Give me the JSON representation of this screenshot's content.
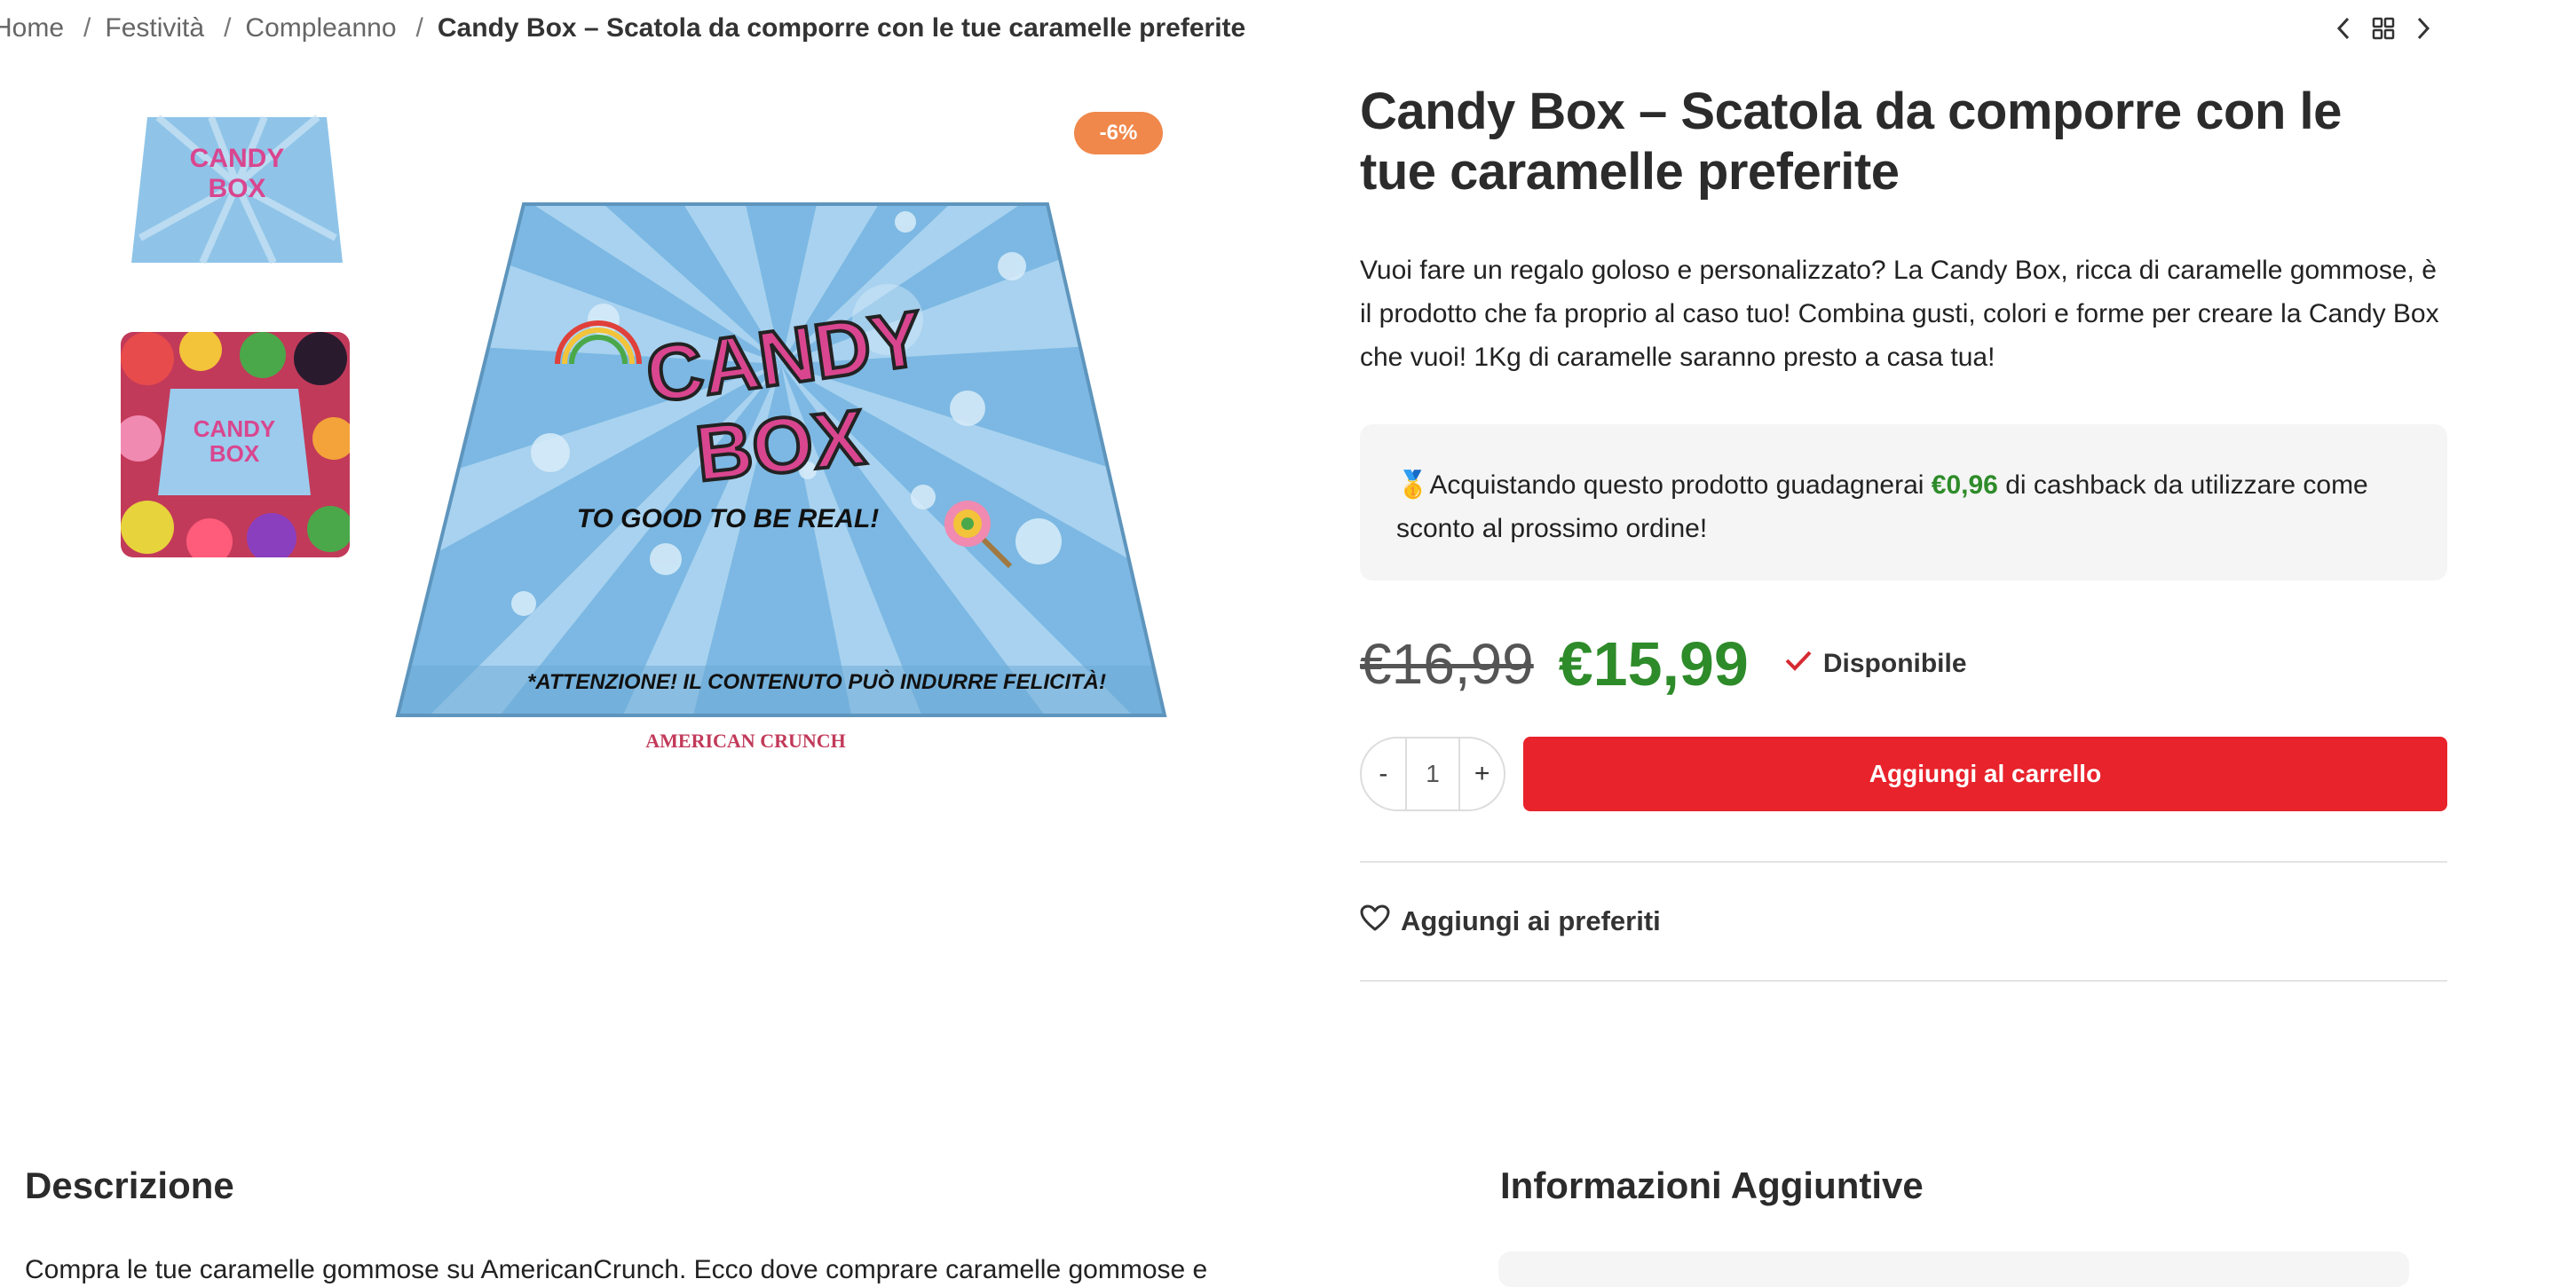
{
  "breadcrumb": {
    "items": [
      "Home",
      "Festività",
      "Compleanno"
    ],
    "current": "Candy Box – Scatola da comporre con le tue caramelle preferite",
    "separator": "/"
  },
  "nav": {
    "prev_icon": "chevron-left-icon",
    "grid_icon": "grid-icon",
    "next_icon": "chevron-right-icon"
  },
  "gallery": {
    "discount_badge": "-6%",
    "box_image": {
      "title_line1": "CANDY",
      "title_line2": "BOX",
      "tagline": "TO GOOD TO BE REAL!",
      "warning": "*ATTENZIONE! IL CONTENUTO PUÒ INDURRE FELICITÀ!",
      "brand": "AMERICAN CRUNCH"
    }
  },
  "product": {
    "title": "Candy Box – Scatola da comporre con le tue caramelle preferite",
    "description": "Vuoi fare un regalo goloso e personalizzato? La Candy Box, ricca di caramelle gommose, è il prodotto che fa proprio al caso tuo! Combina gusti, colori e forme per creare la Candy Box che vuoi! 1Kg di caramelle saranno presto a casa tua!",
    "cashback": {
      "icon": "🥇",
      "before": "Acquistando questo prodotto guadagnerai ",
      "amount": "€0,96",
      "after": " di cashback da utilizzare come sconto al prossimo ordine!"
    },
    "old_price": "€16,99",
    "new_price": "€15,99",
    "stock": "Disponibile",
    "quantity": {
      "minus": "-",
      "value": "1",
      "plus": "+"
    },
    "add_to_cart": "Aggiungi al carrello",
    "wishlist": "Aggiungi ai preferiti"
  },
  "sections": {
    "description_heading": "Descrizione",
    "description_text": "Compra le tue caramelle gommose su AmericanCrunch. Ecco dove comprare caramelle gommose e",
    "info_heading": "Informazioni Aggiuntive"
  },
  "colors": {
    "accent_red": "#e8232c",
    "price_green": "#2e8b2a",
    "badge_orange": "#f0884b"
  }
}
